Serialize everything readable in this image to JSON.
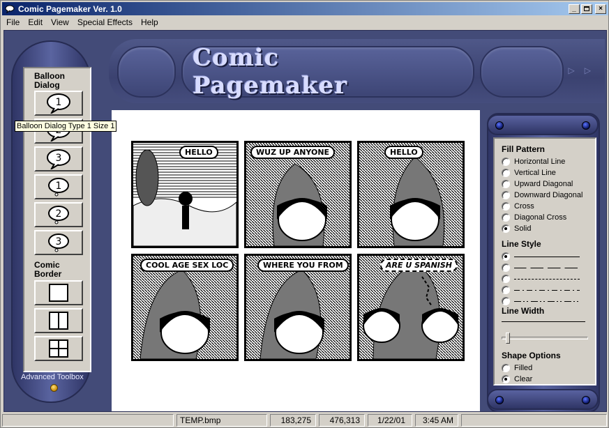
{
  "window": {
    "title": "Comic Pagemaker Ver. 1.0"
  },
  "menu": [
    "File",
    "Edit",
    "View",
    "Special Effects",
    "Help"
  ],
  "banner": {
    "title": "Comic Pagemaker"
  },
  "left_toolbox": {
    "balloon_heading": "Balloon\nDialog",
    "balloon_buttons": [
      {
        "label": "1",
        "style": "speech"
      },
      {
        "label": "2",
        "style": "speech"
      },
      {
        "label": "3",
        "style": "speech"
      },
      {
        "label": "1",
        "style": "thought"
      },
      {
        "label": "2",
        "style": "thought"
      },
      {
        "label": "3",
        "style": "thought"
      }
    ],
    "border_heading": "Comic\nBorder",
    "border_buttons": [
      "single-frame",
      "two-column-frame",
      "four-grid-frame"
    ],
    "footer": "Advanced Toolbox"
  },
  "tooltip": "Balloon Dialog Type 1 Size 1",
  "comic": {
    "panels": [
      {
        "text": "HELLO"
      },
      {
        "text": "WUZ UP ANYONE"
      },
      {
        "text": "HELLO"
      },
      {
        "text": "COOL AGE SEX LOC"
      },
      {
        "text": "WHERE YOU FROM"
      },
      {
        "text": "ARE U SPANISH"
      }
    ]
  },
  "right_toolbox": {
    "fill_heading": "Fill Pattern",
    "fill_options": [
      "Horizontal Line",
      "Vertical Line",
      "Upward Diagonal",
      "Downward Diagonal",
      "Cross",
      "Diagonal Cross",
      "Solid"
    ],
    "fill_selected": "Solid",
    "line_style_heading": "Line Style",
    "line_styles": [
      "solid",
      "dashed-long",
      "dashed",
      "dash-dot",
      "dash-dot-dot"
    ],
    "line_style_selected": "solid",
    "line_width_heading": "Line Width",
    "line_width_value": 0.05,
    "shape_heading": "Shape Options",
    "shape_options": [
      "Filled",
      "Clear"
    ],
    "shape_selected": "Clear"
  },
  "status": {
    "file": "TEMP.bmp",
    "coord1": "183,275",
    "coord2": "476,313",
    "date": "1/22/01",
    "time": "3:45 AM"
  }
}
